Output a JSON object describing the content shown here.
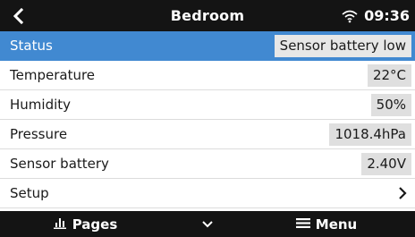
{
  "header": {
    "title": "Bedroom",
    "clock": "09:36",
    "back_icon": "chevron-left-icon",
    "wifi_icon": "wifi-icon"
  },
  "rows": [
    {
      "label": "Status",
      "value": "Sensor battery low",
      "selected": true
    },
    {
      "label": "Temperature",
      "value": "22°C"
    },
    {
      "label": "Humidity",
      "value": "50%"
    },
    {
      "label": "Pressure",
      "value": "1018.4hPa"
    },
    {
      "label": "Sensor battery",
      "value": "2.40V"
    },
    {
      "label": "Setup",
      "icon": "chevron-right-icon"
    }
  ],
  "footer": {
    "pages_label": "Pages",
    "pages_icon": "bar-chart-icon",
    "toggle_icon": "chevron-down-icon",
    "menu_label": "Menu",
    "menu_icon": "hamburger-menu-icon"
  },
  "colors": {
    "header_bg": "#141414",
    "selected_bg": "#4189d1",
    "value_bg": "#dfdfdf"
  }
}
